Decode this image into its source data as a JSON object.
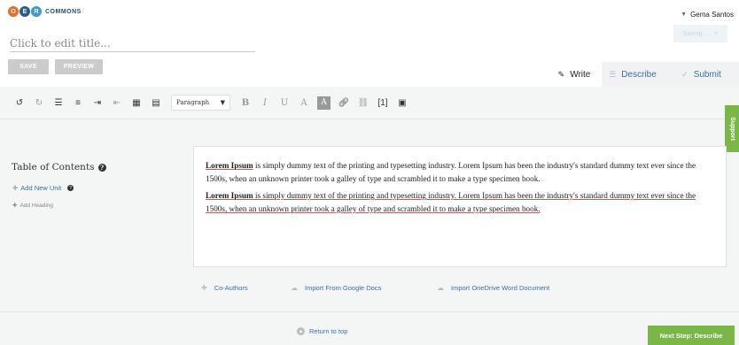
{
  "header": {
    "logo_letters": [
      "O",
      "E",
      "R"
    ],
    "logo_word": "COMMONS",
    "user_name": "Gema Santos",
    "saving_label": "Saving...",
    "saving_close": "×"
  },
  "title": {
    "placeholder": "Click to edit title..."
  },
  "actions": {
    "save_label": "SAVE",
    "preview_label": "PREVIEW"
  },
  "tabs": [
    {
      "label": "Write",
      "icon": "pencil-icon",
      "active": true
    },
    {
      "label": "Describe",
      "icon": "list-icon",
      "active": false
    },
    {
      "label": "Submit",
      "icon": "check-icon",
      "active": false
    }
  ],
  "toolbar": {
    "paragraph_select": "Paragraph",
    "footnote_label": "[1]",
    "bold_glyph": "B",
    "italic_glyph": "I",
    "underline_glyph": "U",
    "text_color_glyph": "A",
    "bg_color_glyph": "A"
  },
  "toc": {
    "title": "Table of Contents",
    "add_unit": "Add New Unit",
    "add_heading": "Add Heading"
  },
  "content": {
    "paragraphs": [
      {
        "bold": "Lorem Ipsum",
        "text": " is simply dummy text of the printing and typesetting industry. Lorem Ipsum has been the industry's standard dummy text ever since the 1500s, when an unknown printer took a galley of type and scrambled it to make a type specimen book."
      },
      {
        "bold": "Lorem Ipsum",
        "text": " is simply dummy text of the printing and typesetting industry. Lorem Ipsum has been the industry's standard dummy text ever since the 1500s, when an unknown printer took a galley of type and scrambled it to make a type specimen book."
      }
    ]
  },
  "side": {
    "support_label": "Support"
  },
  "links": {
    "coauthors": "Co-Authors",
    "import_google": "Import From Google Docs",
    "import_onedrive": "Import OneDrive Word Document"
  },
  "footer": {
    "return_top": "Return to top",
    "next_step": "Next Step: Describe"
  },
  "colors": {
    "accent_blue": "#3b6ea5",
    "green": "#7ab648",
    "gray_button": "#c9cbcd"
  }
}
